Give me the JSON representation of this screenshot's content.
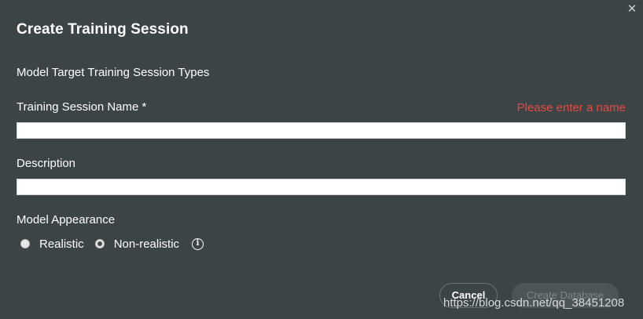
{
  "dialog": {
    "close_glyph": "✕",
    "title": "Create Training Session",
    "session_types_label": "Model Target Training Session Types",
    "name_label": "Training Session Name *",
    "name_error": "Please enter a name",
    "name_value": "",
    "description_label": "Description",
    "description_value": "",
    "appearance_label": "Model Appearance",
    "appearance_options": [
      {
        "label": "Realistic",
        "selected": false
      },
      {
        "label": "Non-realistic",
        "selected": true
      }
    ],
    "info_glyph": "i",
    "cancel_label": "Cancel",
    "create_label": "Create Database"
  },
  "watermark": "https://blog.csdn.net/qq_38451208",
  "colors": {
    "background": "#3c4446",
    "error": "#e8483f",
    "text": "#ffffff"
  }
}
